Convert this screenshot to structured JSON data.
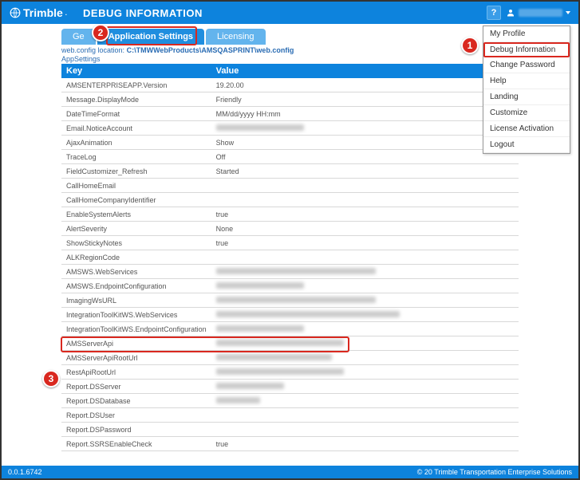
{
  "header": {
    "brand": "Trimble",
    "page_title": "DEBUG INFORMATION",
    "help_label": "?"
  },
  "user_menu": {
    "items": [
      {
        "label": "My Profile"
      },
      {
        "label": "Debug Information"
      },
      {
        "label": "Change Password"
      },
      {
        "label": "Help"
      },
      {
        "label": "Landing"
      },
      {
        "label": "Customize"
      },
      {
        "label": "License Activation"
      },
      {
        "label": "Logout"
      }
    ]
  },
  "tabs": {
    "items": [
      {
        "label": "Ge",
        "active": false
      },
      {
        "label": "Application Settings",
        "active": true
      },
      {
        "label": "Licensing",
        "active": false
      }
    ]
  },
  "config_path_prefix": "web.config location:",
  "config_path_value": "C:\\TMWWebProducts\\AMSQASPRINT\\web.config",
  "section_label": "AppSettings",
  "table": {
    "headers": {
      "key": "Key",
      "value": "Value"
    },
    "rows": [
      {
        "key": "AMSENTERPRISEAPP.Version",
        "value": "19.20.00"
      },
      {
        "key": "Message.DisplayMode",
        "value": "Friendly"
      },
      {
        "key": "DateTimeFormat",
        "value": "MM/dd/yyyy HH:mm"
      },
      {
        "key": "Email.NoticeAccount",
        "value": "",
        "blur": 110
      },
      {
        "key": "AjaxAnimation",
        "value": "Show"
      },
      {
        "key": "TraceLog",
        "value": "Off"
      },
      {
        "key": "FieldCustomizer_Refresh",
        "value": "Started"
      },
      {
        "key": "CallHomeEmail",
        "value": ""
      },
      {
        "key": "CallHomeCompanyIdentifier",
        "value": ""
      },
      {
        "key": "EnableSystemAlerts",
        "value": "true"
      },
      {
        "key": "AlertSeverity",
        "value": "None"
      },
      {
        "key": "ShowStickyNotes",
        "value": "true"
      },
      {
        "key": "ALKRegionCode",
        "value": ""
      },
      {
        "key": "AMSWS.WebServices",
        "value": "",
        "blur": 200
      },
      {
        "key": "AMSWS.EndpointConfiguration",
        "value": "",
        "blur": 110
      },
      {
        "key": "ImagingWsURL",
        "value": "",
        "blur": 200
      },
      {
        "key": "IntegrationToolKitWS.WebServices",
        "value": "",
        "blur": 230
      },
      {
        "key": "IntegrationToolKitWS.EndpointConfiguration",
        "value": "",
        "blur": 110
      },
      {
        "key": "AMSServerApi",
        "value": "",
        "blur": 160,
        "highlight": true
      },
      {
        "key": "AMSServerApiRootUrl",
        "value": "",
        "blur": 145
      },
      {
        "key": "RestApiRootUrl",
        "value": "",
        "blur": 160
      },
      {
        "key": "Report.DSServer",
        "value": "",
        "blur": 85
      },
      {
        "key": "Report.DSDatabase",
        "value": "",
        "blur": 55
      },
      {
        "key": "Report.DSUser",
        "value": ""
      },
      {
        "key": "Report.DSPassword",
        "value": ""
      },
      {
        "key": "Report.SSRSEnableCheck",
        "value": "true"
      }
    ]
  },
  "footer": {
    "version": "0.0.1.6742",
    "copyright": "© 20   Trimble Transportation Enterprise Solutions"
  },
  "callouts": {
    "c1": "1",
    "c2": "2",
    "c3": "3"
  }
}
